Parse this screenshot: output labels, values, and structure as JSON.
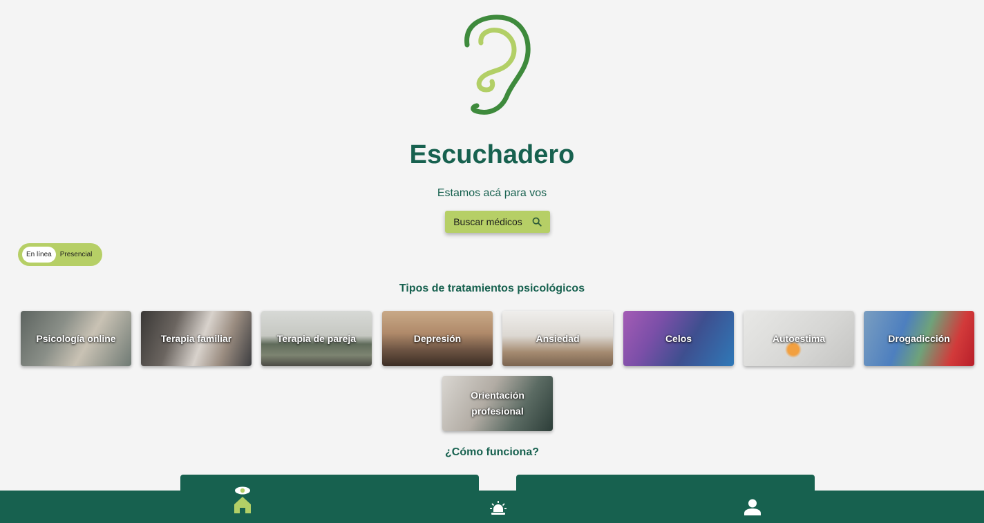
{
  "app": {
    "title": "Escuchadero",
    "tagline": "Estamos acá para vos",
    "logo_icon": "ear-icon"
  },
  "search": {
    "label": "Buscar médicos",
    "icon": "search-icon"
  },
  "mode_toggle": {
    "options": [
      "En línea",
      "Presencial"
    ],
    "selected": "En línea"
  },
  "treatments": {
    "title": "Tipos de tratamientos psicológicos",
    "items": [
      {
        "label": "Psicología online"
      },
      {
        "label": "Terapia familiar"
      },
      {
        "label": "Terapia de pareja"
      },
      {
        "label": "Depresión"
      },
      {
        "label": "Ansiedad"
      },
      {
        "label": "Celos"
      },
      {
        "label": "Autoestima"
      },
      {
        "label": "Drogadicción"
      },
      {
        "label": "Orientación profesional"
      }
    ]
  },
  "how_it_works": {
    "title": "¿Cómo funciona?"
  },
  "bottom_nav": {
    "items": [
      {
        "name": "home",
        "icon": "home-icon",
        "active": true
      },
      {
        "name": "alerts",
        "icon": "siren-icon",
        "active": false
      },
      {
        "name": "profile",
        "icon": "user-icon",
        "active": false
      }
    ]
  },
  "colors": {
    "primary": "#17614f",
    "accent": "#b6cf66",
    "background": "#f4f4f4",
    "logo_dark": "#3e8a3c"
  }
}
